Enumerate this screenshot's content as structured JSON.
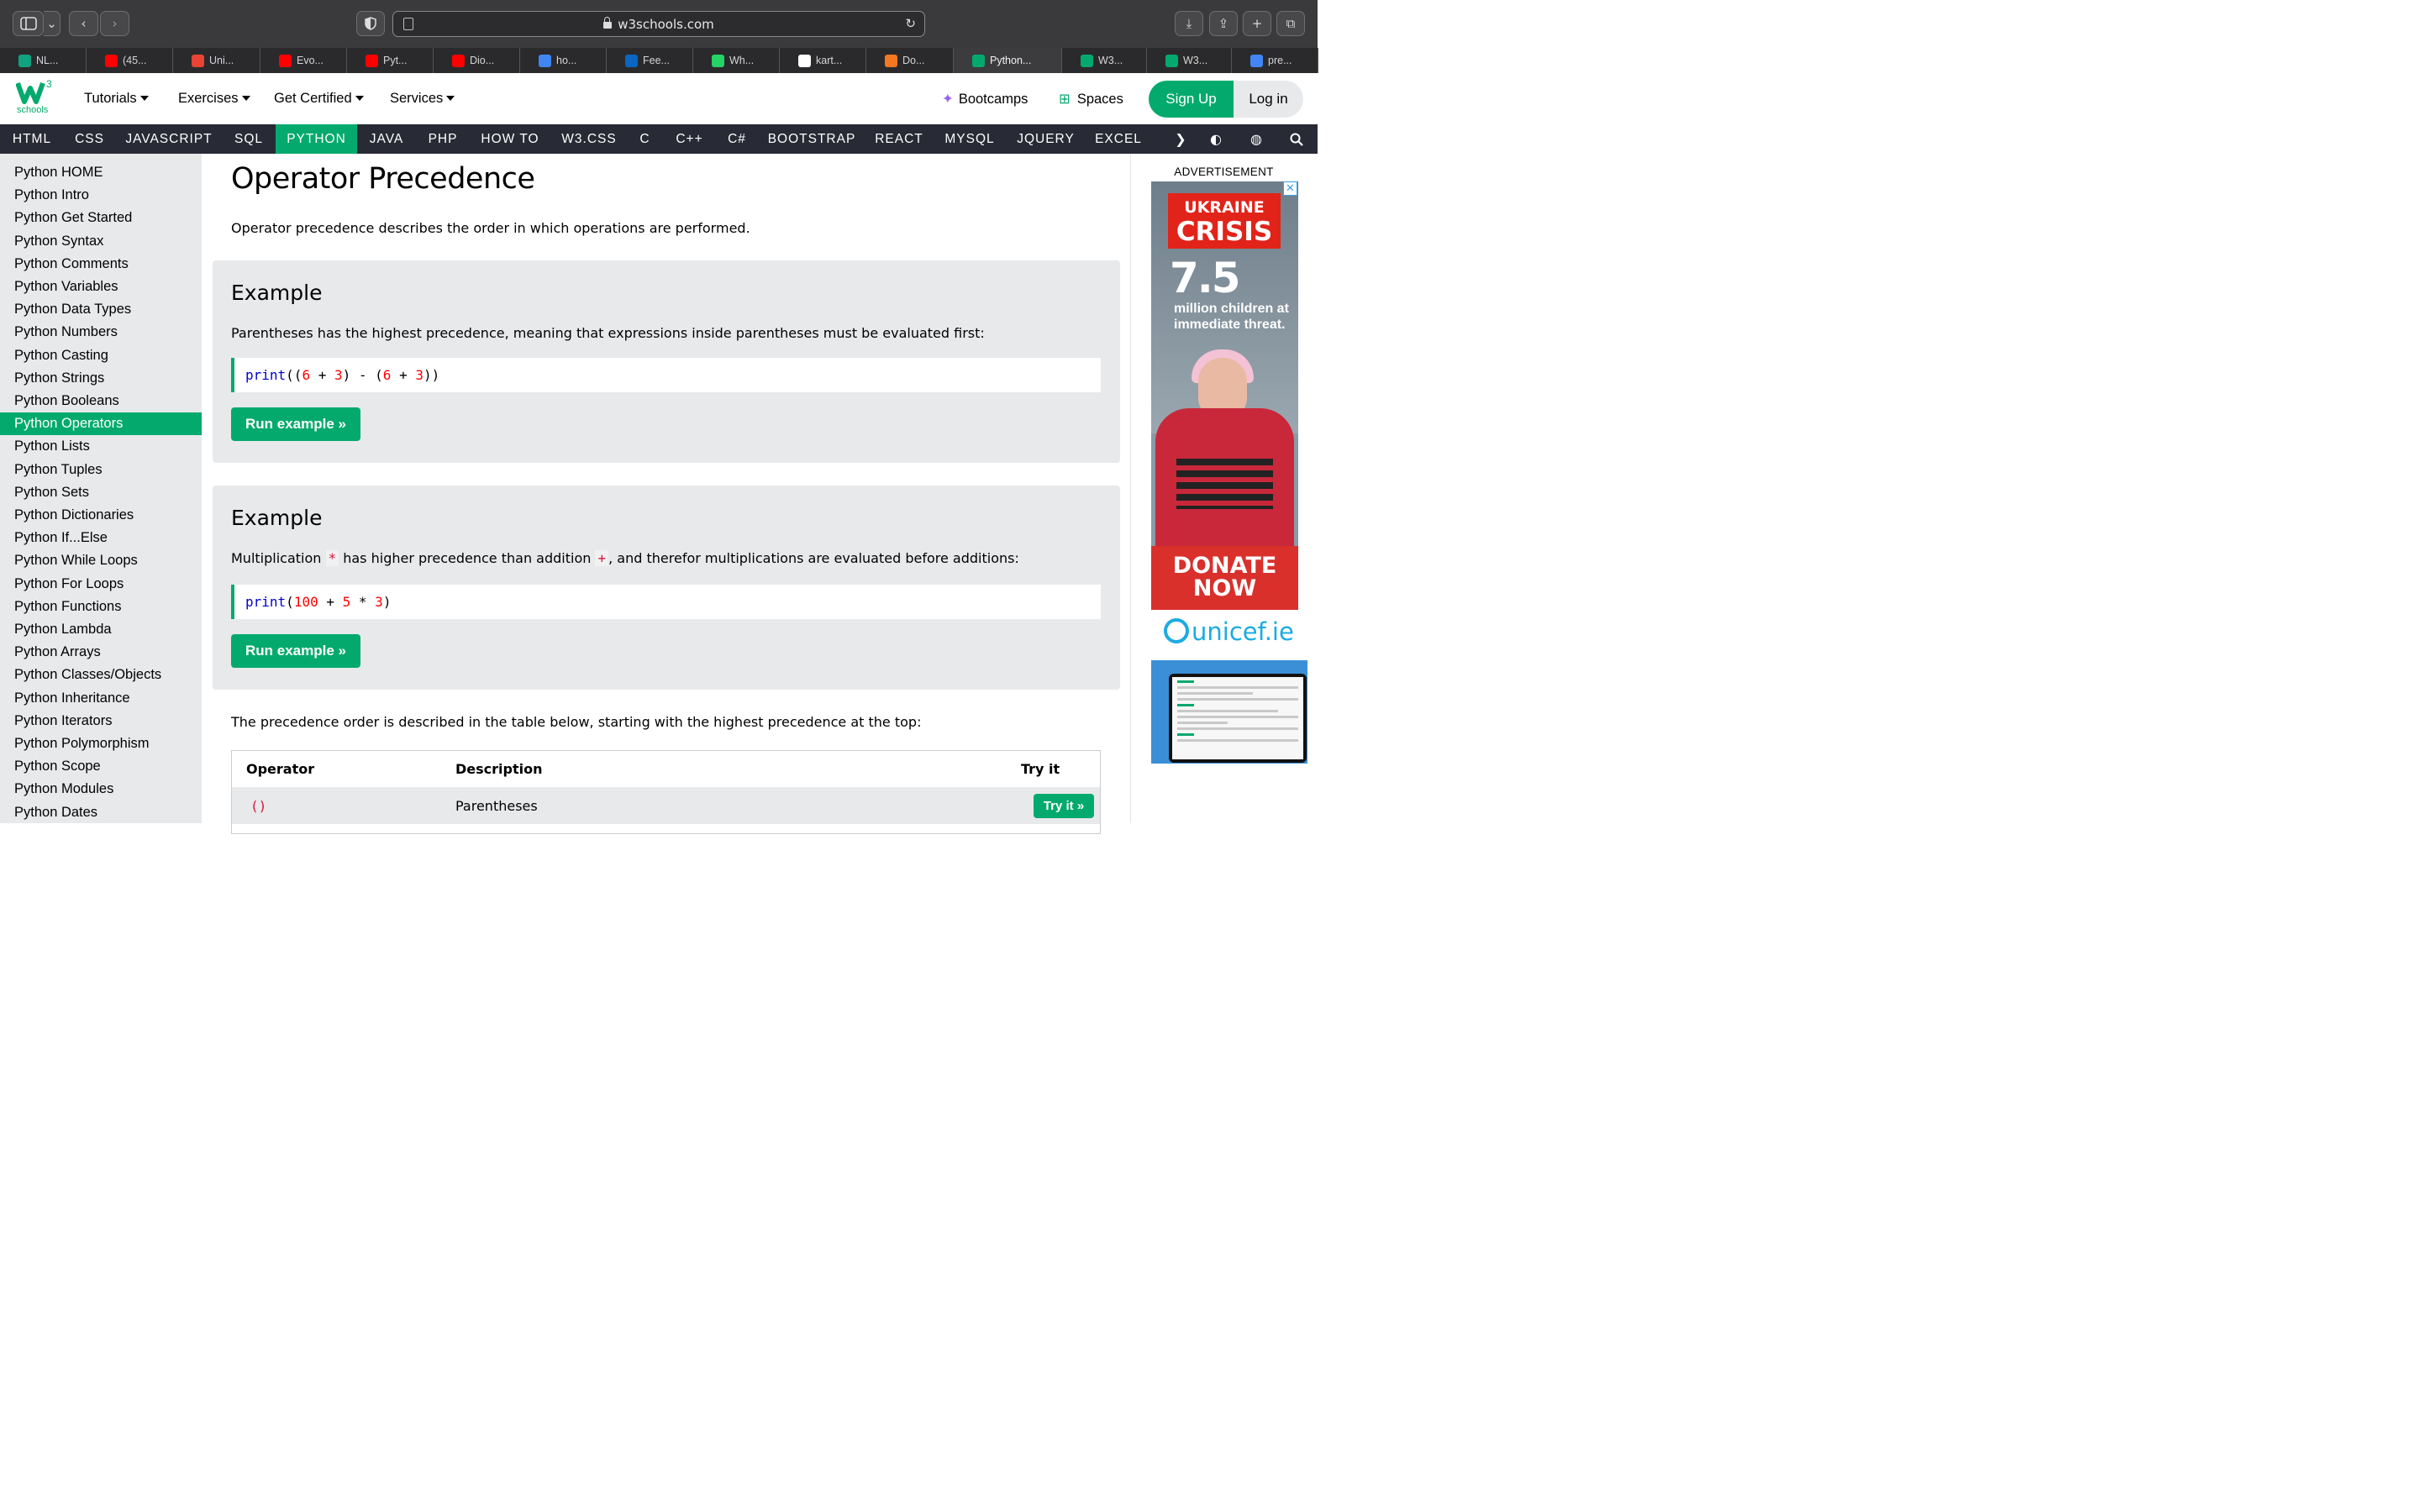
{
  "browser": {
    "url": "w3schools.com",
    "tabs": [
      {
        "label": "NL...",
        "icon": "openai-icon",
        "color": "#10a37f"
      },
      {
        "label": "(45...",
        "icon": "youtube-icon",
        "color": "#ff0000"
      },
      {
        "label": "Uni...",
        "icon": "gmail-icon",
        "color": "#ea4335"
      },
      {
        "label": "Evo...",
        "icon": "youtube-icon",
        "color": "#ff0000"
      },
      {
        "label": "Pyt...",
        "icon": "youtube-icon",
        "color": "#ff0000"
      },
      {
        "label": "Dio...",
        "icon": "youtube-icon",
        "color": "#ff0000"
      },
      {
        "label": "ho...",
        "icon": "google-icon",
        "color": "#4285f4"
      },
      {
        "label": "Fee...",
        "icon": "linkedin-icon",
        "color": "#0a66c2"
      },
      {
        "label": "Wh...",
        "icon": "whatsapp-icon",
        "color": "#25d366"
      },
      {
        "label": "kart...",
        "icon": "github-icon",
        "color": "#ffffff"
      },
      {
        "label": "Do...",
        "icon": "loading-icon",
        "color": "#f47721"
      },
      {
        "label": "Python...",
        "icon": "w3schools-icon",
        "color": "#04aa6d"
      },
      {
        "label": "W3...",
        "icon": "w3schools-icon",
        "color": "#04aa6d"
      },
      {
        "label": "W3...",
        "icon": "w3schools-icon",
        "color": "#04aa6d"
      },
      {
        "label": "pre...",
        "icon": "google-icon",
        "color": "#4285f4"
      }
    ]
  },
  "header": {
    "logo_sup": "3",
    "logo_sub": "schools",
    "menu": [
      "Tutorials",
      "Exercises",
      "Get Certified",
      "Services"
    ],
    "bootcamps": "Bootcamps",
    "spaces": "Spaces",
    "signup": "Sign Up",
    "login": "Log in"
  },
  "topics": [
    "HTML",
    "CSS",
    "JAVASCRIPT",
    "SQL",
    "PYTHON",
    "JAVA",
    "PHP",
    "HOW TO",
    "W3.CSS",
    "C",
    "C++",
    "C#",
    "BOOTSTRAP",
    "REACT",
    "MYSQL",
    "JQUERY",
    "EXCEL"
  ],
  "sidebar": {
    "items": [
      "Python HOME",
      "Python Intro",
      "Python Get Started",
      "Python Syntax",
      "Python Comments",
      "Python Variables",
      "Python Data Types",
      "Python Numbers",
      "Python Casting",
      "Python Strings",
      "Python Booleans",
      "Python Operators",
      "Python Lists",
      "Python Tuples",
      "Python Sets",
      "Python Dictionaries",
      "Python If...Else",
      "Python While Loops",
      "Python For Loops",
      "Python Functions",
      "Python Lambda",
      "Python Arrays",
      "Python Classes/Objects",
      "Python Inheritance",
      "Python Iterators",
      "Python Polymorphism",
      "Python Scope",
      "Python Modules",
      "Python Dates"
    ],
    "active": "Python Operators"
  },
  "main": {
    "title": "Operator Precedence",
    "intro": "Operator precedence describes the order in which operations are performed.",
    "example1": {
      "heading": "Example",
      "text": "Parentheses has the highest precedence, meaning that expressions inside parentheses must be evaluated first:",
      "code": {
        "fn": "print",
        "p1": "((",
        "n1": "6",
        "p2": " + ",
        "n2": "3",
        "p3": ") - (",
        "n3": "6",
        "p4": " + ",
        "n4": "3",
        "p5": "))"
      },
      "button": "Run example »"
    },
    "example2": {
      "heading": "Example",
      "text_a": "Multiplication",
      "op_a": "*",
      "text_b": "has higher precedence than addition",
      "op_b": "+",
      "text_c": ", and therefor multiplications are evaluated before additions:",
      "code": {
        "fn": "print",
        "p1": "(",
        "n1": "100",
        "p2": " + ",
        "n2": "5",
        "p3": " * ",
        "n3": "3",
        "p4": ")"
      },
      "button": "Run example »"
    },
    "table_intro": "The precedence order is described in the table below, starting with the highest precedence at the top:",
    "table": {
      "headers": [
        "Operator",
        "Description",
        "Try it"
      ],
      "rows": [
        {
          "operator": "()",
          "description": "Parentheses",
          "try": "Try it »"
        }
      ]
    }
  },
  "ad": {
    "label": "ADVERTISEMENT",
    "badge_a": "UKRAINE",
    "badge_b": "CRISIS",
    "big": "7.5",
    "text": "million children at immediate threat.",
    "donate": "DONATE NOW",
    "brand": "unicef.ie",
    "close": "✕"
  }
}
